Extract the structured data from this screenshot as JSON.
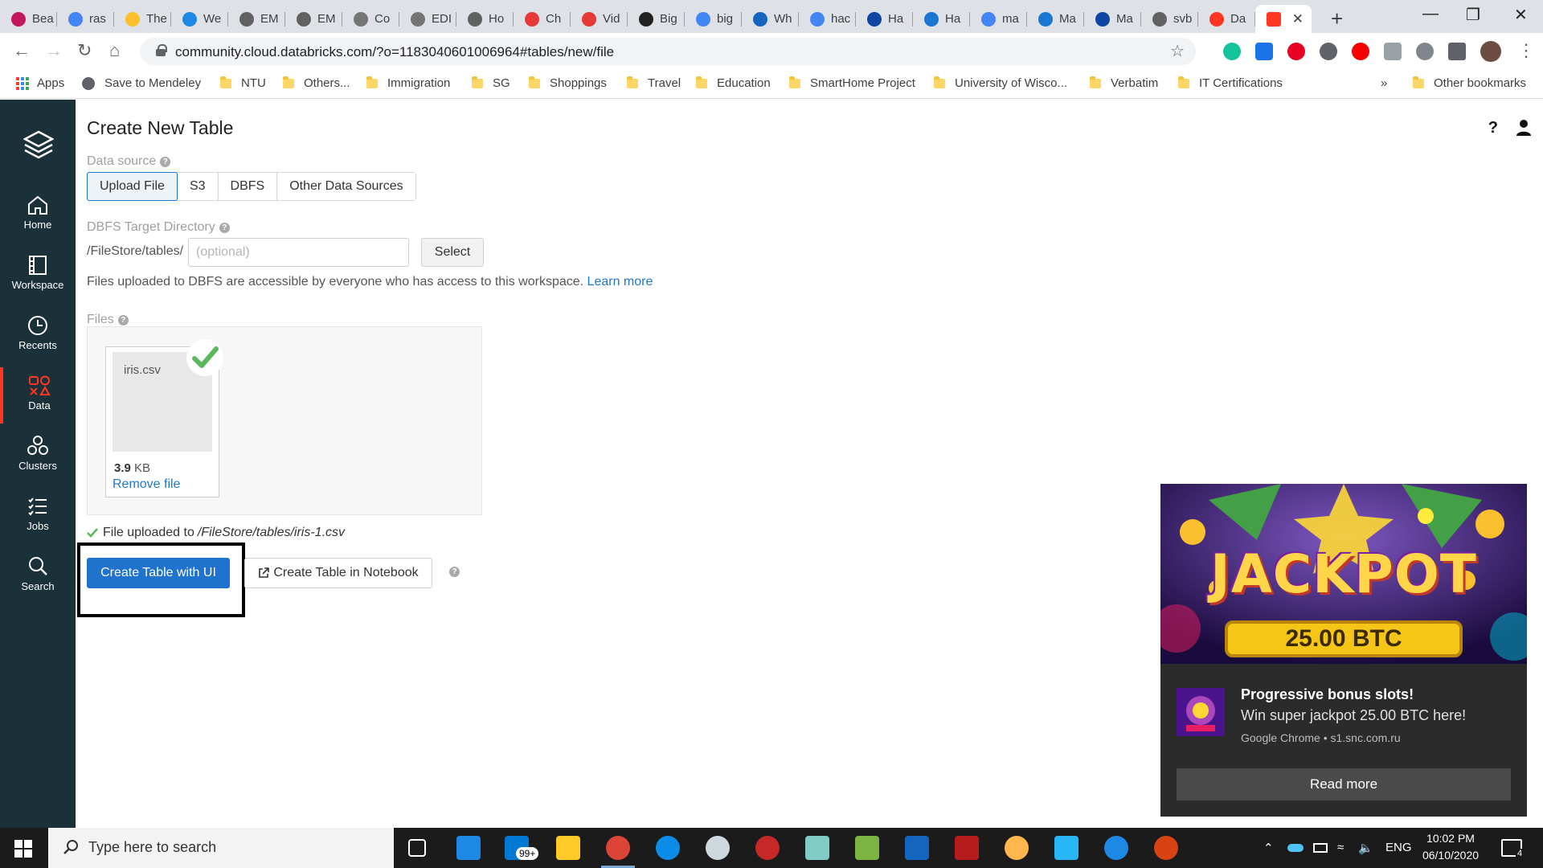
{
  "browser": {
    "tabs": [
      {
        "label": "Bea",
        "color": "#c2185b"
      },
      {
        "label": "ras",
        "color": "#4285f4"
      },
      {
        "label": "The",
        "color": "#fbc02d"
      },
      {
        "label": "We",
        "color": "#1e88e5"
      },
      {
        "label": "EM",
        "color": "#616161"
      },
      {
        "label": "EM",
        "color": "#616161"
      },
      {
        "label": "Co",
        "color": "#757575"
      },
      {
        "label": "EDI",
        "color": "#757575"
      },
      {
        "label": "Ho",
        "color": "#616161"
      },
      {
        "label": "Ch",
        "color": "#e53935"
      },
      {
        "label": "Vid",
        "color": "#e53935"
      },
      {
        "label": "Big",
        "color": "#212121"
      },
      {
        "label": "big",
        "color": "#4285f4"
      },
      {
        "label": "Wh",
        "color": "#1565c0"
      },
      {
        "label": "hac",
        "color": "#4285f4"
      },
      {
        "label": "Ha",
        "color": "#0d47a1"
      },
      {
        "label": "Ha",
        "color": "#1976d2"
      },
      {
        "label": "ma",
        "color": "#4285f4"
      },
      {
        "label": "Ma",
        "color": "#1976d2"
      },
      {
        "label": "Ma",
        "color": "#0d47a1"
      },
      {
        "label": "svb",
        "color": "#616161"
      },
      {
        "label": "Da",
        "color": "#ff3621"
      }
    ],
    "active_tab_color": "#ff3621",
    "url": "community.cloud.databricks.com/?o=1183040601006964#tables/new/file"
  },
  "bookmarks": {
    "apps_label": "Apps",
    "mendeley_label": "Save to Mendeley",
    "folders": [
      "NTU",
      "Others...",
      "Immigration",
      "SG",
      "Shoppings",
      "Travel",
      "Education",
      "SmartHome Project",
      "University of Wisco...",
      "Verbatim",
      "IT Certifications"
    ],
    "overflow": "»",
    "other": "Other bookmarks"
  },
  "sidebar": {
    "items": [
      {
        "label": "Home",
        "icon": "home-icon"
      },
      {
        "label": "Workspace",
        "icon": "workspace-icon"
      },
      {
        "label": "Recents",
        "icon": "clock-icon"
      },
      {
        "label": "Data",
        "icon": "data-icon"
      },
      {
        "label": "Clusters",
        "icon": "clusters-icon"
      },
      {
        "label": "Jobs",
        "icon": "jobs-icon"
      },
      {
        "label": "Search",
        "icon": "search-icon"
      }
    ],
    "active": "Data",
    "accent": "#ff3621"
  },
  "page": {
    "title": "Create New Table",
    "help": "?",
    "data_source_label": "Data source",
    "source_tabs": [
      "Upload File",
      "S3",
      "DBFS",
      "Other Data Sources"
    ],
    "dbfs_label": "DBFS Target Directory",
    "dbfs_prefix": "/FileStore/tables/",
    "dbfs_placeholder": "(optional)",
    "select_label": "Select",
    "dbfs_note": "Files uploaded to DBFS are accessible by everyone who has access to this workspace.",
    "learn_more": "Learn more",
    "files_label": "Files",
    "file": {
      "name": "iris.csv",
      "size_value": "3.9",
      "size_unit": "KB",
      "remove_label": "Remove file"
    },
    "upload_message": "File uploaded to",
    "upload_path": "/FileStore/tables/iris-1.csv",
    "create_ui_label": "Create Table with UI",
    "create_notebook_label": "Create Table in Notebook",
    "primary_color": "#1f73cc",
    "link_color": "#1f77c9"
  },
  "ad": {
    "headline": "JACKPOT",
    "amount": "25.00 BTC",
    "title": "Progressive bonus slots!",
    "subtitle": "Win super jackpot 25.00 BTC here!",
    "source": "Google Chrome • s1.snc.com.ru",
    "button": "Read more"
  },
  "taskbar": {
    "search_placeholder": "Type here to search",
    "mail_badge": "99+",
    "language": "ENG",
    "time": "10:02 PM",
    "date": "06/10/2020",
    "notification_count": "4"
  }
}
